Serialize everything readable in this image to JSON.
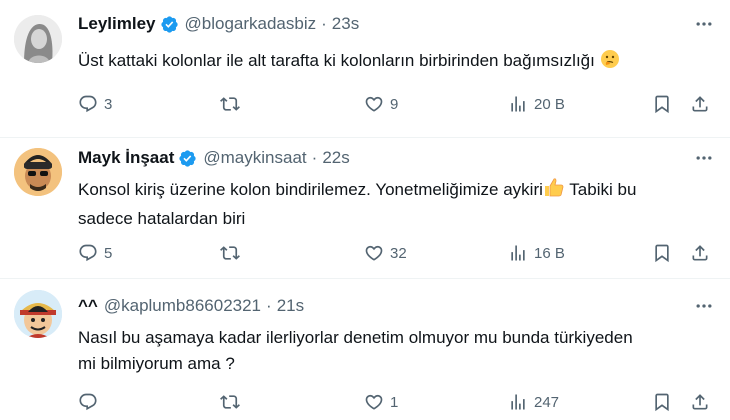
{
  "tweets": [
    {
      "name": "Leylimley",
      "verified": true,
      "handle": "@blogarkadasbiz",
      "separator": "·",
      "time": "23s",
      "text": "Üst kattaki kolonlar ile alt tarafta ki kolonların birbirinden bağımsızlığı",
      "emoji": "thinking-face-emoji",
      "replies": "3",
      "retweets": "",
      "likes": "9",
      "views": "20 B"
    },
    {
      "name": "Mayk İnşaat",
      "verified": true,
      "handle": "@maykinsaat",
      "separator": "·",
      "time": "22s",
      "text_line1": "Konsol kiriş üzerine kolon bindirilemez. Yonetmeliğimize aykiri",
      "emoji": "thumbs-up-emoji",
      "text_line1_after": " Tabiki bu",
      "text_line2": "sadece hatalardan biri",
      "replies": "5",
      "retweets": "",
      "likes": "32",
      "views": "16 B"
    },
    {
      "name": "^^",
      "verified": false,
      "handle": "@kaplumb86602321",
      "separator": "·",
      "time": "21s",
      "text_line1": "Nasıl bu aşamaya kadar ilerliyorlar denetim olmuyor mu bunda türkiyeden",
      "text_line2": "mi bilmiyorum ama ?",
      "replies": "",
      "retweets": "",
      "likes": "1",
      "views": "247"
    }
  ],
  "colors": {
    "text": "#0f1419",
    "secondary": "#536471",
    "verified": "#1d9bf0",
    "divider": "#eff3f4",
    "emoji_yellow": "#ffcc4d"
  },
  "icons": [
    "more-icon",
    "reply-icon",
    "retweet-icon",
    "like-icon",
    "views-icon",
    "bookmark-icon",
    "share-icon",
    "verified-badge-icon"
  ]
}
